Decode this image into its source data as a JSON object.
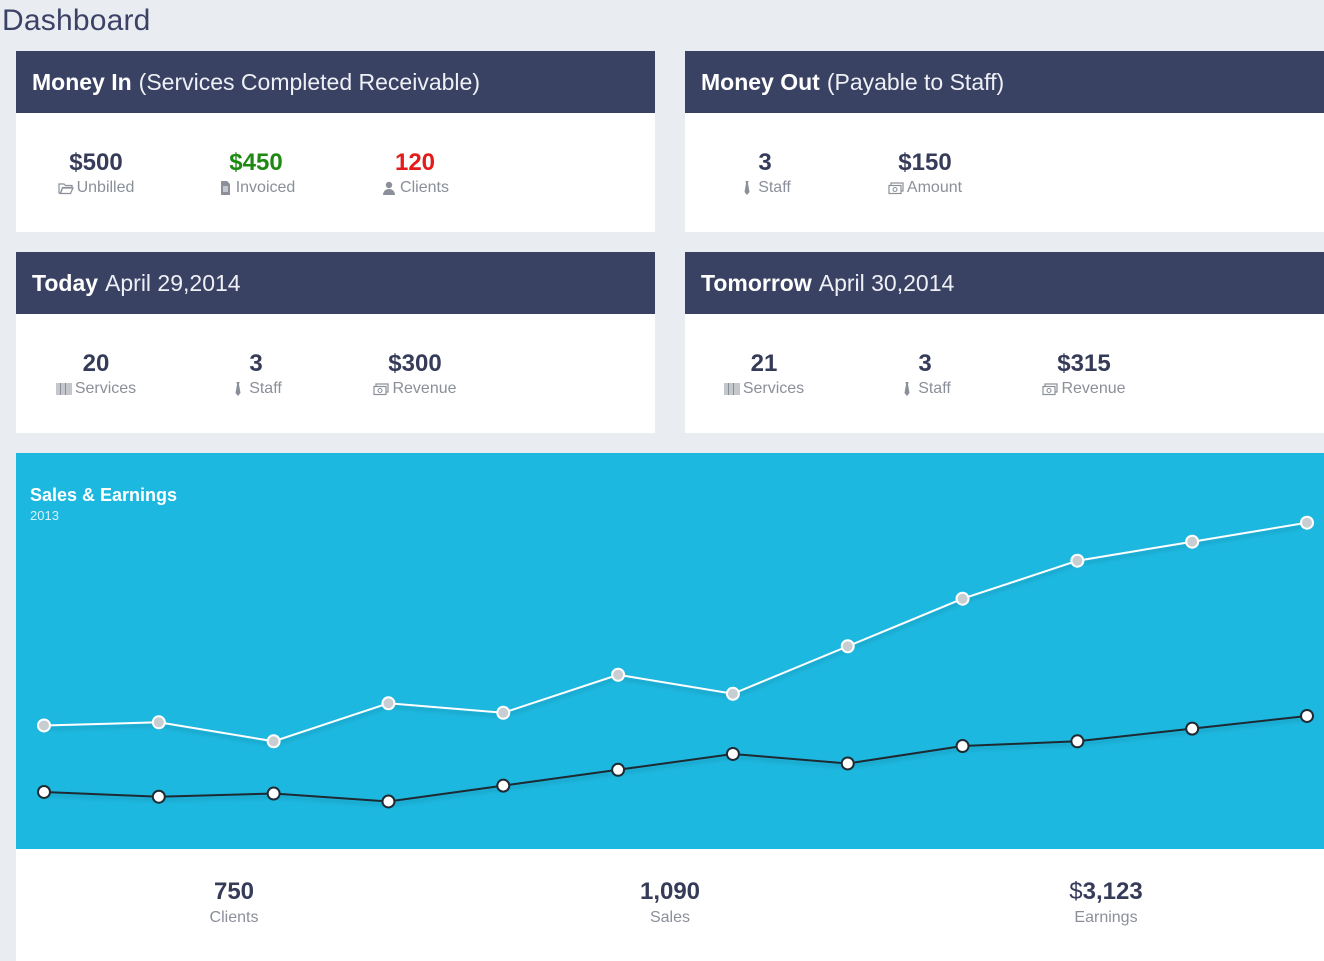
{
  "page_title": "Dashboard",
  "money_in": {
    "title_strong": "Money In",
    "title_light": "(Services Completed Receivable)",
    "stats": [
      {
        "value": "$500",
        "label": "Unbilled",
        "icon": "folder-open-icon"
      },
      {
        "value": "$450",
        "label": "Invoiced",
        "icon": "document-icon",
        "color": "#1e8a12"
      },
      {
        "value": "120",
        "label": "Clients",
        "icon": "user-icon",
        "color": "#e31b1b"
      }
    ]
  },
  "money_out": {
    "title_strong": "Money Out",
    "title_light": "(Payable to Staff)",
    "stats": [
      {
        "value": "3",
        "label": "Staff",
        "icon": "tie-icon"
      },
      {
        "value": "$150",
        "label": "Amount",
        "icon": "money-icon"
      }
    ]
  },
  "today": {
    "title_strong": "Today",
    "title_light": "April 29,2014",
    "stats": [
      {
        "value": "20",
        "label": "Services",
        "icon": "barcode-icon"
      },
      {
        "value": "3",
        "label": "Staff",
        "icon": "tie-icon"
      },
      {
        "value": "$300",
        "label": "Revenue",
        "icon": "money-icon"
      }
    ]
  },
  "tomorrow": {
    "title_strong": "Tomorrow",
    "title_light": "April 30,2014",
    "stats": [
      {
        "value": "21",
        "label": "Services",
        "icon": "barcode-icon"
      },
      {
        "value": "3",
        "label": "Staff",
        "icon": "tie-icon"
      },
      {
        "value": "$315",
        "label": "Revenue",
        "icon": "money-icon"
      }
    ]
  },
  "chart": {
    "title": "Sales & Earnings",
    "subtitle": "2013"
  },
  "chart_data": {
    "type": "line",
    "title": "Sales & Earnings",
    "subtitle": "2013",
    "x": [
      1,
      2,
      3,
      4,
      5,
      6,
      7,
      8,
      9,
      10,
      11,
      12
    ],
    "series": [
      {
        "values": [
          39,
          40,
          34,
          46,
          43,
          55,
          49,
          64,
          79,
          91,
          97,
          103
        ],
        "color": "#ffffff",
        "point_fill": "#c8cdd2"
      },
      {
        "values": [
          18,
          16.5,
          17.5,
          15,
          20,
          25,
          30,
          27,
          32.5,
          34,
          38,
          42
        ],
        "color": "#1f2a33",
        "point_fill": "#ffffff"
      }
    ],
    "ylim": [
      0,
      125
    ],
    "grid": false,
    "legend": "none"
  },
  "summary": {
    "stats": [
      {
        "value": "750",
        "label": "Clients"
      },
      {
        "value": "1,090",
        "label": "Sales"
      },
      {
        "currency": "$",
        "value": "3,123",
        "label": "Earnings"
      }
    ]
  },
  "colors": {
    "header_bg": "#3a4263",
    "chart_bg": "#1db8e0",
    "page_bg": "#e9edf2"
  }
}
